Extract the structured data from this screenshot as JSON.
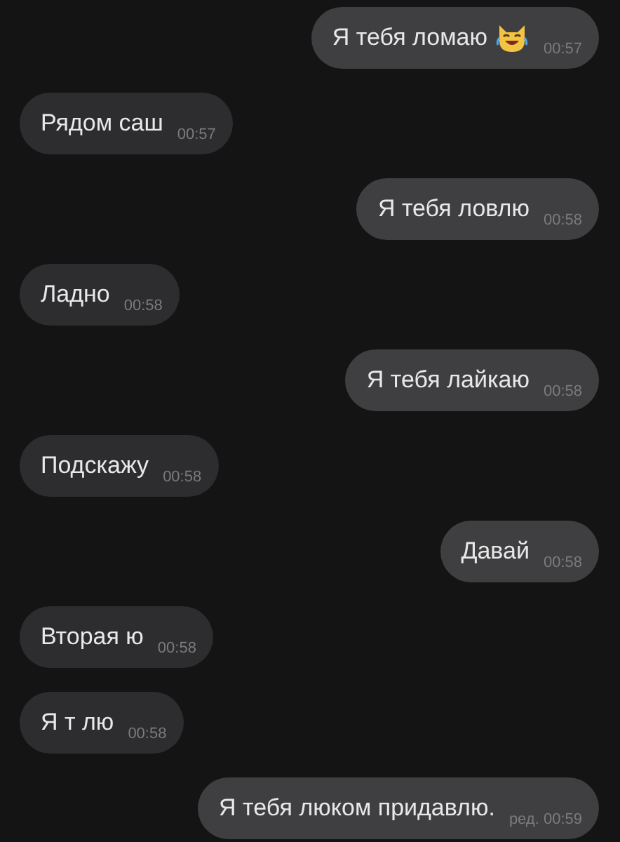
{
  "messages": [
    {
      "kind": "outgoing",
      "text": "Я тебя ломаю",
      "emoji": true,
      "time": "00:57"
    },
    {
      "kind": "incoming",
      "text": "Рядом саш",
      "time": "00:57"
    },
    {
      "kind": "outgoing",
      "text": "Я тебя ловлю",
      "time": "00:58"
    },
    {
      "kind": "incoming",
      "text": "Ладно",
      "time": "00:58"
    },
    {
      "kind": "outgoing",
      "text": "Я тебя лайкаю",
      "time": "00:58"
    },
    {
      "kind": "incoming",
      "text": "Подскажу",
      "time": "00:58"
    },
    {
      "kind": "outgoing",
      "text": "Давай",
      "time": "00:58"
    },
    {
      "kind": "incoming",
      "text": "Вторая ю",
      "time": "00:58"
    },
    {
      "kind": "incoming",
      "text": "Я т лю",
      "time": "00:58"
    },
    {
      "kind": "outgoing",
      "text": "Я тебя люком придавлю.",
      "edited": "ред.",
      "time": "00:59"
    }
  ]
}
